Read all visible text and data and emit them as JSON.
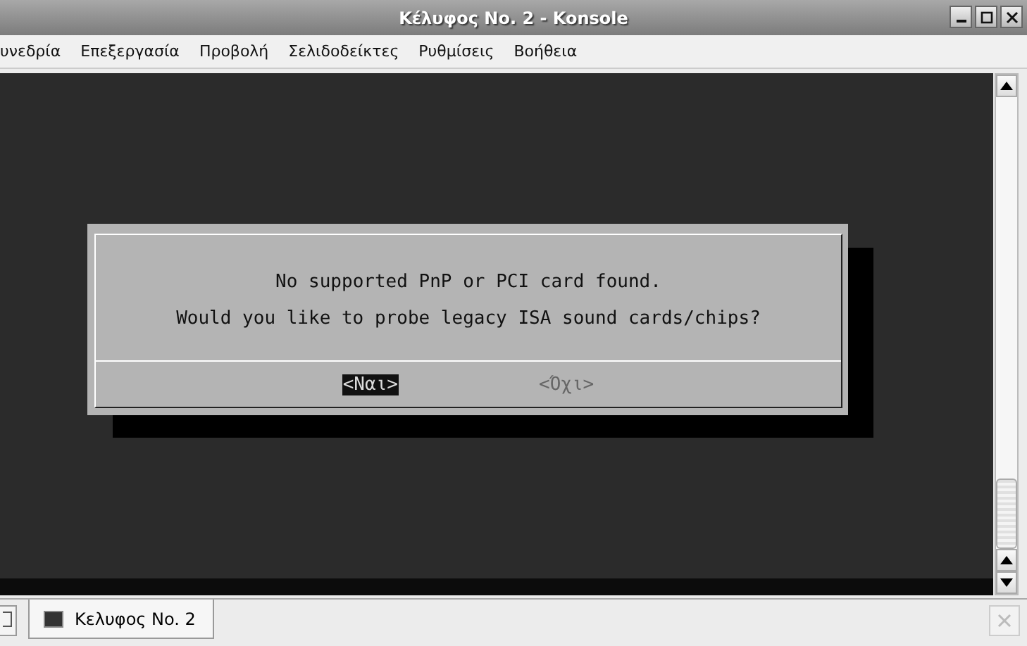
{
  "window": {
    "title": "Κέλυφος No. 2 - Konsole"
  },
  "menu": [
    "υνεδρία",
    "Επεξεργασία",
    "Προβολή",
    "Σελιδοδείκτες",
    "Ρυθμίσεις",
    "Βοήθεια"
  ],
  "dialog": {
    "lines": [
      "No supported PnP or PCI card found.",
      "Would you like to probe legacy ISA sound cards/chips?"
    ],
    "buttons": [
      {
        "label": "<Ναι>",
        "selected": true
      },
      {
        "label": "<Όχι>",
        "selected": false
      }
    ]
  },
  "tabs": [
    {
      "label": "Κελυφος No. 2",
      "selected": true
    }
  ]
}
